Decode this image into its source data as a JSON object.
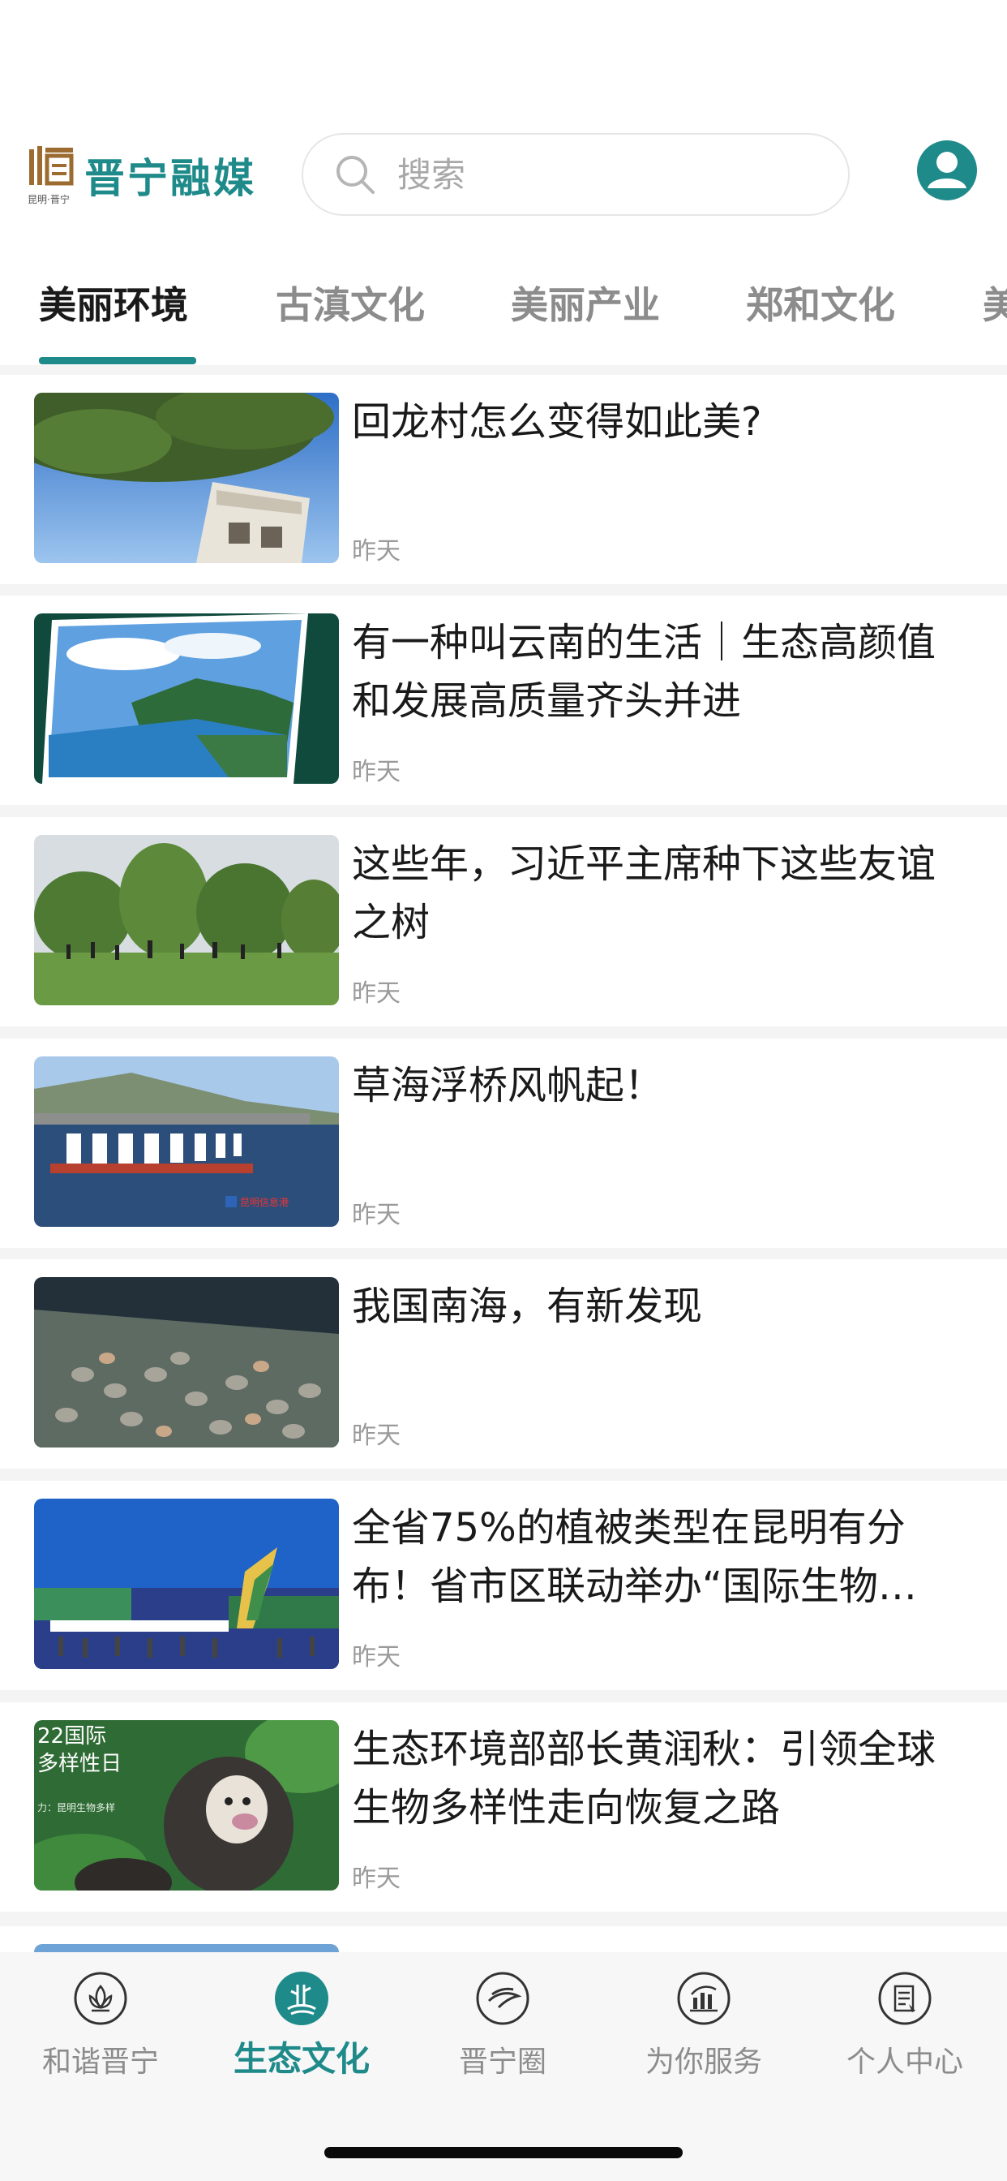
{
  "header": {
    "logo_text": "晋宁融媒",
    "logo_caption": "昆明·晋宁",
    "search_placeholder": "搜索"
  },
  "tabs": [
    {
      "label": "美丽环境",
      "active": true
    },
    {
      "label": "古滇文化",
      "active": false
    },
    {
      "label": "美丽产业",
      "active": false
    },
    {
      "label": "郑和文化",
      "active": false
    },
    {
      "label": "美",
      "active": false
    }
  ],
  "articles": [
    {
      "title": "回龙村怎么变得如此美?",
      "time": "昨天"
    },
    {
      "title": "有一种叫云南的生活｜生态高颜值和发展高质量齐头并进",
      "time": "昨天"
    },
    {
      "title": "这些年，习近平主席种下这些友谊之树",
      "time": "昨天"
    },
    {
      "title": "草海浮桥风帆起！",
      "time": "昨天"
    },
    {
      "title": "我国南海，有新发现",
      "time": "昨天"
    },
    {
      "title": "全省75%的植被类型在昆明有分布！省市区联动举办“国际生物…",
      "time": "昨天"
    },
    {
      "title": "生态环境部部长黄润秋：引领全球生物多样性走向恢复之路",
      "time": "昨天"
    }
  ],
  "thumb_texts": {
    "lake_watermark": "昆明信息港",
    "poster_line1": "22国际",
    "poster_line2": "多样性日",
    "poster_line3": "力：昆明生物多样"
  },
  "bottom_nav": [
    {
      "label": "和谐晋宁",
      "icon": "lotus-icon",
      "active": false
    },
    {
      "label": "生态文化",
      "icon": "eco-icon",
      "active": true
    },
    {
      "label": "晋宁圈",
      "icon": "circle-bird-icon",
      "active": false
    },
    {
      "label": "为你服务",
      "icon": "service-chart-icon",
      "active": false
    },
    {
      "label": "个人中心",
      "icon": "profile-doc-icon",
      "active": false
    }
  ],
  "colors": {
    "accent": "#1f8a8a",
    "inactive": "#8c8c8c",
    "time": "#9a9a9a"
  }
}
